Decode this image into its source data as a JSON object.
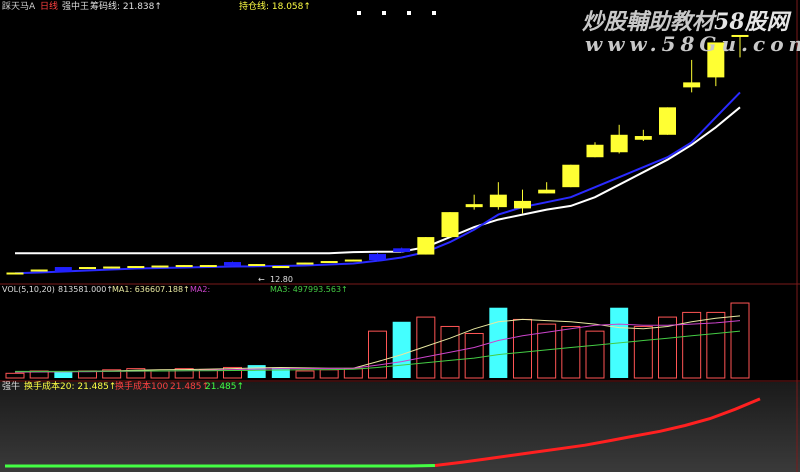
{
  "watermark": {
    "line1_left": "炒股輔助教材",
    "line1_right": "58股网",
    "line2": "www.58Gu.com"
  },
  "colors": {
    "background": "#000000",
    "bull_candle": "#ffff33",
    "bear_candle": "#2020ff",
    "ma_blue": "#2a2aff",
    "ma_white": "#ffffff",
    "panel_border": "#7a1a1a",
    "vol_up": "#ff5555",
    "vol_down": "#44ffff",
    "vol_ma1": "#e8e8a0",
    "vol_ma2": "#cc44cc",
    "vol_ma3": "#44cc44",
    "turnover_red": "#ff2020",
    "turnover_green": "#44ff44"
  },
  "price_header": [
    {
      "text": "踩天马A",
      "color": "#cccccc"
    },
    {
      "text": "日线",
      "color": "#ff4040"
    },
    {
      "text": "强中王",
      "color": "#dddddd"
    },
    {
      "text": "筹码线: 21.838↑",
      "color": "#e0e0e0"
    },
    {
      "text": "",
      "color": "#2a2aff"
    },
    {
      "text": "持仓线: 18.058↑",
      "color": "#ffff44"
    }
  ],
  "volume_header": [
    {
      "text": "VOL(5,10,20)",
      "color": "#dddddd"
    },
    {
      "text": "813581.000↑",
      "color": "#dddddd"
    },
    {
      "text": "MA1: 636607.188↑",
      "color": "#e8e8a0"
    },
    {
      "text": "MA2:",
      "color": "#cc44cc"
    },
    {
      "text": "MA3: 497993.563↑",
      "color": "#44cc44"
    }
  ],
  "turnover_header": [
    {
      "text": "强牛",
      "color": "#dddddd"
    },
    {
      "text": "换手成本20: 21.485↑",
      "color": "#ffff44"
    },
    {
      "text": "换手成本100",
      "color": "#ff4040"
    },
    {
      "text": "21.485↑",
      "color": "#ff4040"
    },
    {
      "text": "21.485↑",
      "color": "#44ff44"
    }
  ],
  "chart_data": [
    {
      "type": "candlestick",
      "panel": "price",
      "low_label": "12.80",
      "candles": [
        {
          "o": 12.3,
          "c": 12.38,
          "h": 12.38,
          "l": 12.3
        },
        {
          "o": 12.42,
          "c": 12.5,
          "h": 12.5,
          "l": 12.42
        },
        {
          "o": 12.6,
          "c": 12.4,
          "h": 12.6,
          "l": 12.4
        },
        {
          "o": 12.52,
          "c": 12.6,
          "h": 12.6,
          "l": 12.52
        },
        {
          "o": 12.55,
          "c": 12.62,
          "h": 12.62,
          "l": 12.55
        },
        {
          "o": 12.58,
          "c": 12.64,
          "h": 12.64,
          "l": 12.58
        },
        {
          "o": 12.6,
          "c": 12.66,
          "h": 12.66,
          "l": 12.6
        },
        {
          "o": 12.62,
          "c": 12.68,
          "h": 12.68,
          "l": 12.62
        },
        {
          "o": 12.62,
          "c": 12.68,
          "h": 12.68,
          "l": 12.62
        },
        {
          "o": 12.8,
          "c": 12.66,
          "h": 12.82,
          "l": 12.64
        },
        {
          "o": 12.66,
          "c": 12.72,
          "h": 12.72,
          "l": 12.66
        },
        {
          "o": 12.58,
          "c": 12.64,
          "h": 12.64,
          "l": 12.58
        },
        {
          "o": 12.72,
          "c": 12.78,
          "h": 12.78,
          "l": 12.72
        },
        {
          "o": 12.78,
          "c": 12.84,
          "h": 12.84,
          "l": 12.78
        },
        {
          "o": 12.84,
          "c": 12.9,
          "h": 12.9,
          "l": 12.84
        },
        {
          "o": 13.12,
          "c": 12.88,
          "h": 13.16,
          "l": 12.82
        },
        {
          "o": 13.35,
          "c": 13.2,
          "h": 13.38,
          "l": 13.18
        },
        {
          "o": 13.1,
          "c": 13.8,
          "h": 13.8,
          "l": 13.1
        },
        {
          "o": 13.8,
          "c": 14.8,
          "h": 14.8,
          "l": 13.8
        },
        {
          "o": 15.0,
          "c": 15.12,
          "h": 15.5,
          "l": 14.9
        },
        {
          "o": 15.0,
          "c": 15.5,
          "h": 16.0,
          "l": 14.9
        },
        {
          "o": 14.95,
          "c": 15.25,
          "h": 15.7,
          "l": 14.75
        },
        {
          "o": 15.55,
          "c": 15.7,
          "h": 16.0,
          "l": 15.55
        },
        {
          "o": 15.8,
          "c": 16.7,
          "h": 16.7,
          "l": 15.8
        },
        {
          "o": 17.0,
          "c": 17.5,
          "h": 17.6,
          "l": 17.0
        },
        {
          "o": 17.2,
          "c": 17.9,
          "h": 18.3,
          "l": 17.15
        },
        {
          "o": 17.7,
          "c": 17.85,
          "h": 18.1,
          "l": 17.65
        },
        {
          "o": 17.9,
          "c": 19.0,
          "h": 19.0,
          "l": 17.9
        },
        {
          "o": 19.8,
          "c": 20.0,
          "h": 20.9,
          "l": 19.6
        },
        {
          "o": 20.2,
          "c": 21.6,
          "h": 21.6,
          "l": 19.85
        },
        {
          "o": 21.9,
          "c": 21.9,
          "h": 21.9,
          "l": 21.0
        }
      ],
      "ma_blue": [
        12.35,
        12.38,
        12.42,
        12.46,
        12.5,
        12.54,
        12.56,
        12.58,
        12.6,
        12.62,
        12.63,
        12.64,
        12.66,
        12.7,
        12.74,
        12.85,
        12.98,
        13.2,
        13.6,
        14.1,
        14.7,
        15.0,
        15.2,
        15.4,
        15.8,
        16.2,
        16.6,
        17.0,
        17.6,
        18.6,
        19.6
      ],
      "ma_white": [
        13.15,
        13.15,
        13.15,
        13.15,
        13.15,
        13.15,
        13.15,
        13.15,
        13.15,
        13.15,
        13.15,
        13.15,
        13.15,
        13.15,
        13.2,
        13.21,
        13.22,
        13.4,
        13.8,
        14.2,
        14.5,
        14.7,
        14.9,
        15.05,
        15.4,
        15.9,
        16.4,
        16.9,
        17.5,
        18.2,
        19.0
      ],
      "watermark_badges": [
        4
      ]
    },
    {
      "type": "bar",
      "panel": "volume",
      "values": [
        2,
        3,
        2.5,
        3,
        3.5,
        4,
        3,
        4,
        3.5,
        4.5,
        5.5,
        4.5,
        3,
        3.5,
        4,
        20,
        24,
        26,
        22,
        19,
        30,
        25,
        23,
        22,
        20,
        30,
        22,
        26,
        28,
        28,
        32
      ],
      "up": [
        true,
        true,
        false,
        true,
        true,
        true,
        true,
        true,
        true,
        true,
        false,
        false,
        true,
        true,
        true,
        true,
        false,
        true,
        true,
        true,
        false,
        true,
        true,
        true,
        true,
        false,
        true,
        true,
        true,
        true,
        true
      ],
      "ma1": [
        2.5,
        2.6,
        2.7,
        2.8,
        3.0,
        3.3,
        3.5,
        3.6,
        3.8,
        4.0,
        4.3,
        4.5,
        4.3,
        4.2,
        4.2,
        7.0,
        10.0,
        13.5,
        17.0,
        21.0,
        24.0,
        25.0,
        24.5,
        24.0,
        23.0,
        21.5,
        21.0,
        22.0,
        24.0,
        25.5,
        26.5
      ],
      "ma2": [
        2.6,
        2.6,
        2.7,
        2.7,
        2.8,
        2.9,
        3.0,
        3.1,
        3.3,
        3.5,
        3.8,
        4.0,
        4.0,
        4.1,
        4.2,
        5.5,
        7.0,
        9.0,
        11.0,
        13.0,
        16.0,
        18.0,
        19.5,
        21.0,
        22.5,
        23.0,
        22.5,
        22.5,
        23.0,
        23.5,
        24.5
      ],
      "ma3": [
        2.8,
        2.8,
        2.8,
        2.9,
        2.9,
        3.0,
        3.0,
        3.1,
        3.1,
        3.2,
        3.3,
        3.4,
        3.5,
        3.6,
        3.7,
        4.5,
        5.5,
        6.5,
        7.5,
        8.5,
        10.0,
        11.0,
        12.0,
        13.0,
        14.0,
        15.0,
        16.0,
        17.0,
        18.0,
        19.0,
        20.0
      ],
      "ylim": [
        0,
        35
      ]
    },
    {
      "type": "line",
      "panel": "turnover",
      "green_segment": [
        0,
        0,
        0,
        0,
        0,
        0,
        0,
        0,
        0,
        0,
        0,
        0,
        0,
        0,
        0,
        0,
        0,
        0.2
      ],
      "red_segment": [
        0.2,
        1.5,
        3,
        4.5,
        6,
        7.5,
        9,
        11,
        13,
        15,
        17.5,
        20.5,
        24.5,
        29
      ],
      "ylim": [
        0,
        32
      ]
    }
  ]
}
